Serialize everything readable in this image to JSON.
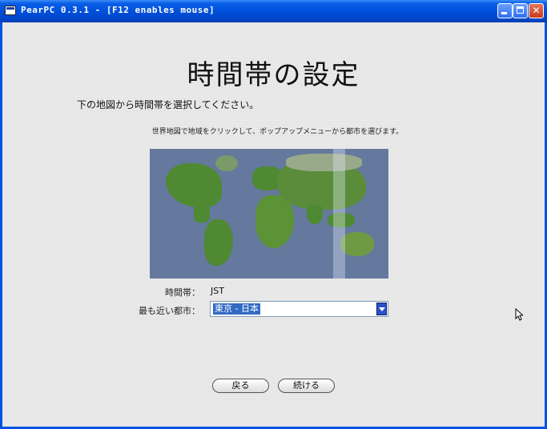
{
  "window": {
    "title": "PearPC 0.3.1 - [F12 enables mouse]",
    "buttons": {
      "minimize": "_",
      "maximize": "□",
      "close": "✕"
    }
  },
  "page": {
    "title": "時間帯の設定",
    "instruction": "下の地図から時間帯を選択してください。",
    "sub_instruction": "世界地図で地域をクリックして、ポップアップメニューから都市を選びます。"
  },
  "timezone": {
    "label": "時間帯：",
    "value": "JST"
  },
  "city": {
    "label": "最も近い都市：",
    "selected": "東京 - 日本"
  },
  "nav": {
    "back": "戻る",
    "next": "続ける"
  },
  "colors": {
    "titlebar": "#0050dc",
    "ocean": "#65789e",
    "land": "#4f8a32",
    "selection": "#316ac5"
  }
}
